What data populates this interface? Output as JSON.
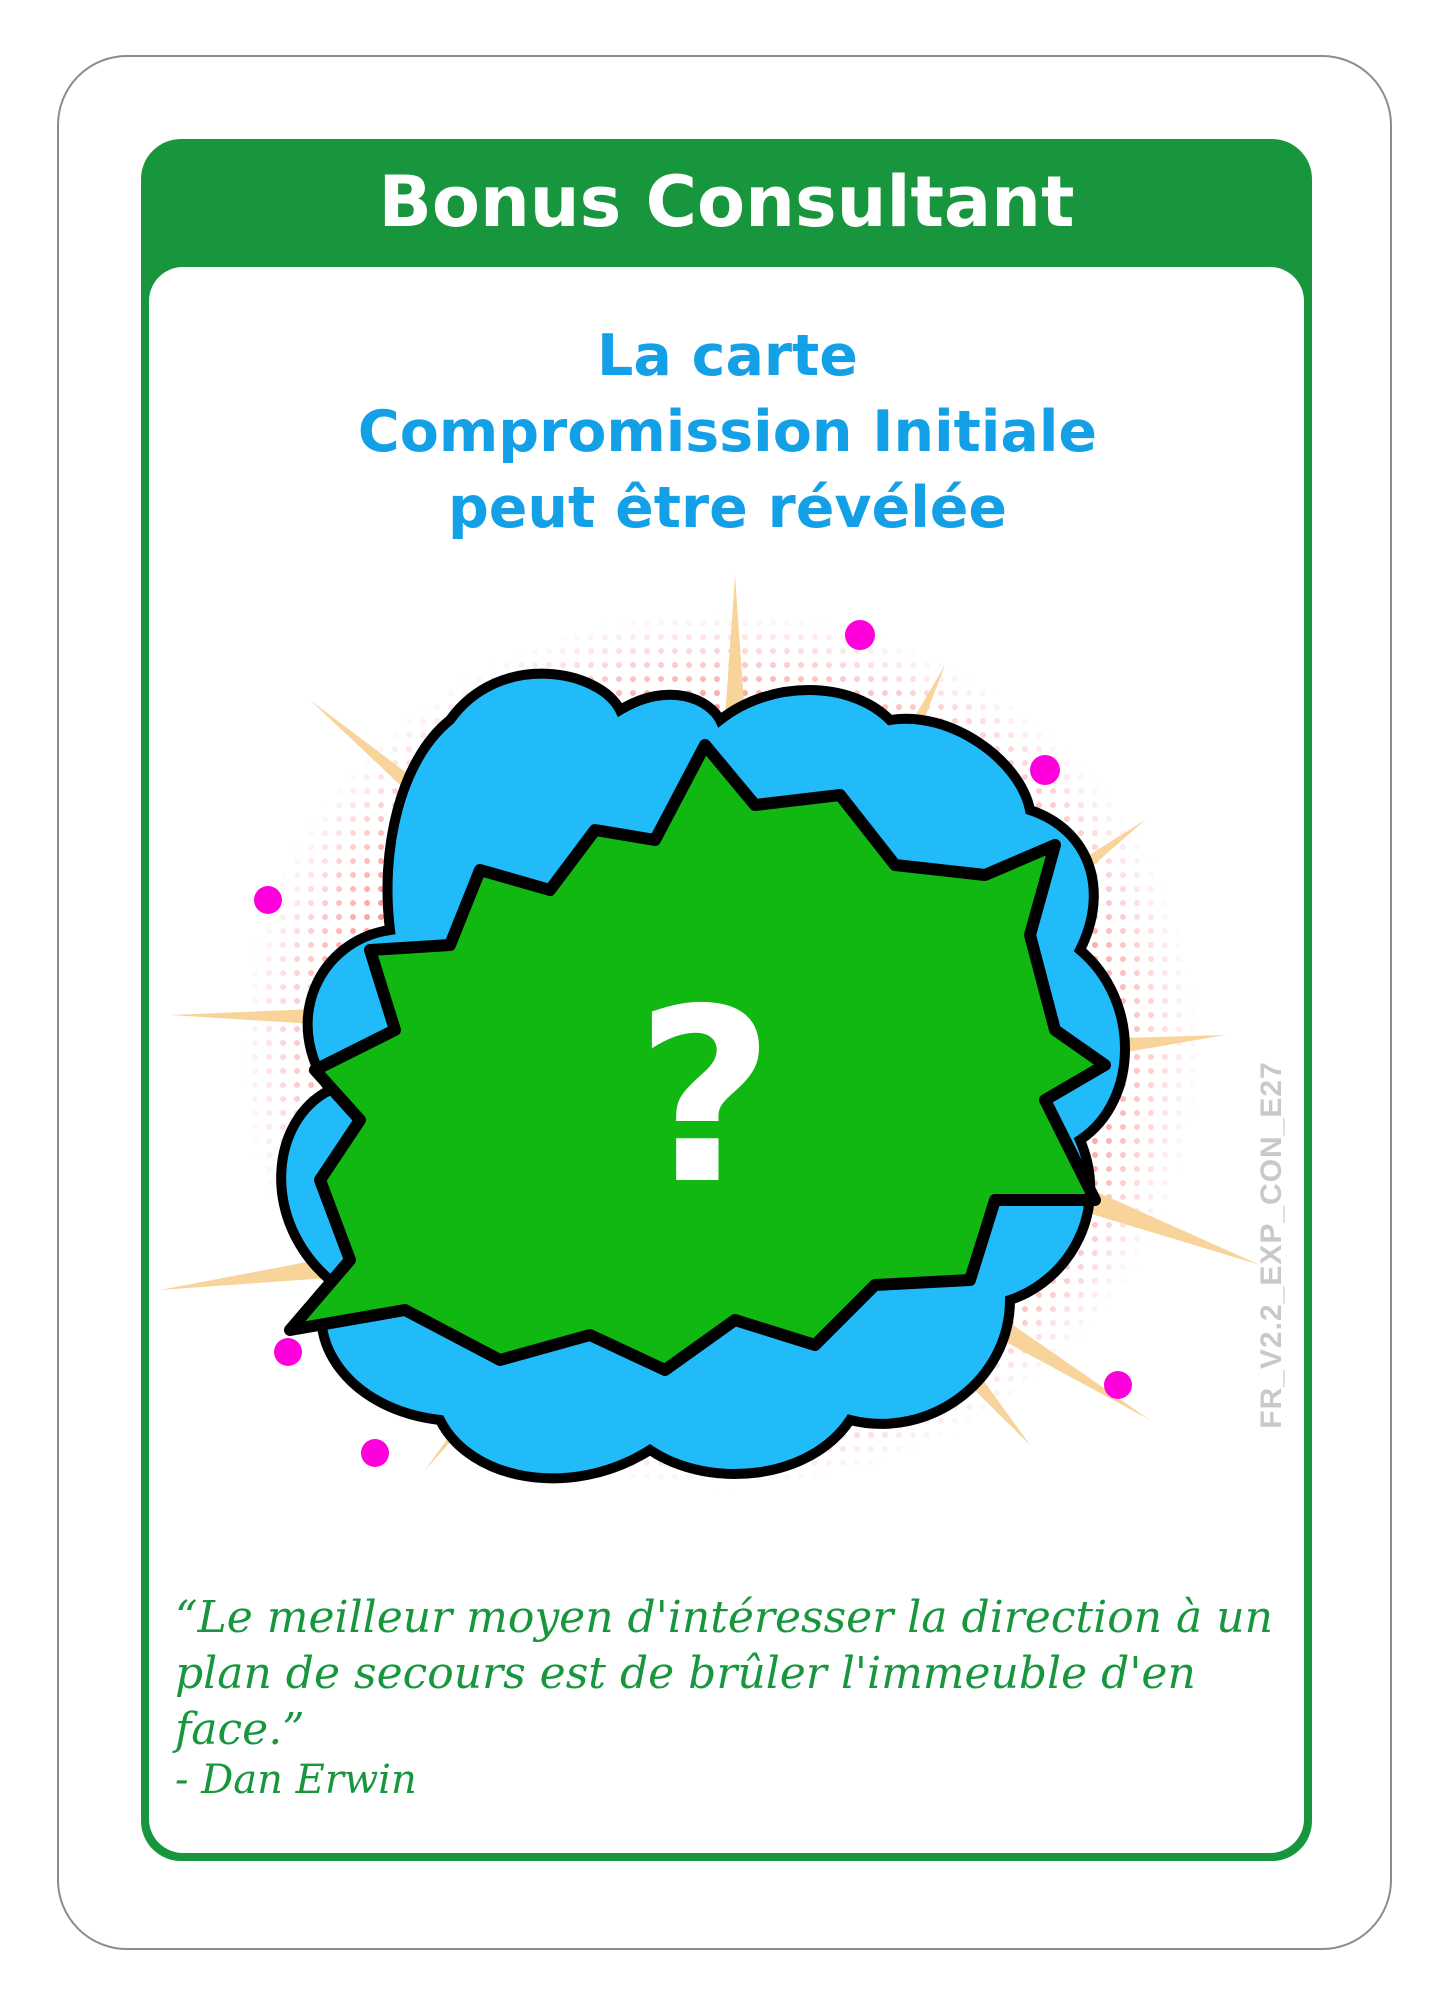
{
  "card": {
    "title": "Bonus Consultant",
    "subtitle_lines": [
      "La carte",
      "Compromission Initiale",
      "peut être révélée"
    ],
    "illustration": {
      "symbol": "?",
      "icon": "question-mark-explosion-icon"
    },
    "quote": "“Le meilleur moyen d'intéresser la direction à un plan de secours est de brûler l'immeuble d'en face.”",
    "author": "- Dan Erwin",
    "code": "FR_V2.2_EXP_CON_E27"
  },
  "colors": {
    "frame": "#18963e",
    "subtitle": "#14a0e6",
    "burst": "#12b812",
    "cloud": "#22bbfa",
    "rays": "#f8d49a",
    "halftone": "#ff2a2a",
    "dots": "#ff00dd",
    "quote": "#18963e",
    "code": "#c9c9c9"
  }
}
